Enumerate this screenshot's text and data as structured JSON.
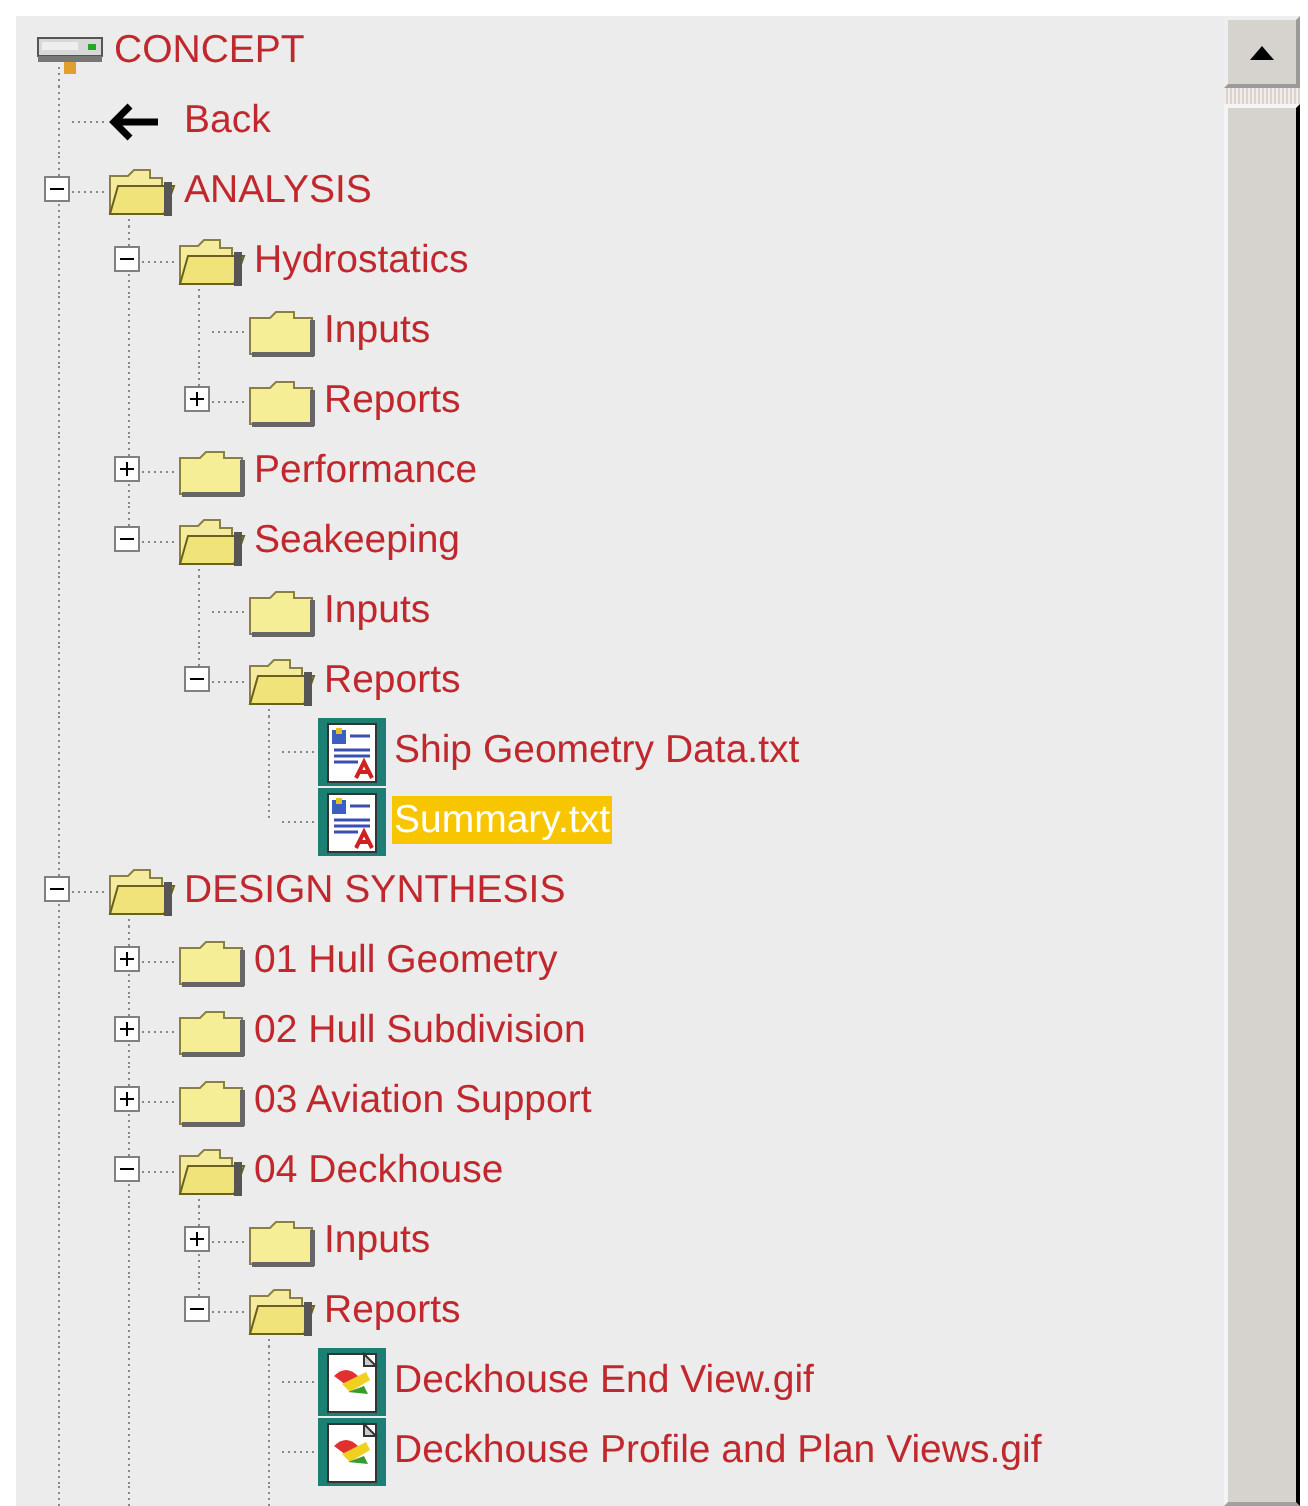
{
  "tree": [
    {
      "label": "CONCEPT",
      "kind": "root",
      "selected": false,
      "children": [
        {
          "label": "Back",
          "kind": "back",
          "selected": false
        },
        {
          "label": "ANALYSIS",
          "kind": "folder",
          "selected": false,
          "expanded": true,
          "children": [
            {
              "label": "Hydrostatics",
              "kind": "folder",
              "selected": false,
              "expanded": true,
              "children": [
                {
                  "label": "Inputs",
                  "kind": "folder",
                  "selected": false
                },
                {
                  "label": "Reports",
                  "kind": "folder",
                  "selected": false,
                  "expanded": false
                }
              ]
            },
            {
              "label": "Performance",
              "kind": "folder",
              "selected": false,
              "expanded": false
            },
            {
              "label": "Seakeeping",
              "kind": "folder",
              "selected": false,
              "expanded": true,
              "children": [
                {
                  "label": "Inputs",
                  "kind": "folder",
                  "selected": false
                },
                {
                  "label": "Reports",
                  "kind": "folder",
                  "selected": false,
                  "expanded": true,
                  "children": [
                    {
                      "label": "Ship Geometry Data.txt",
                      "kind": "text_file",
                      "selected": false
                    },
                    {
                      "label": "Summary.txt",
                      "kind": "text_file",
                      "selected": true
                    }
                  ]
                }
              ]
            }
          ]
        },
        {
          "label": "DESIGN SYNTHESIS",
          "kind": "folder",
          "selected": false,
          "expanded": true,
          "children": [
            {
              "label": "01 Hull Geometry",
              "kind": "folder",
              "selected": false,
              "expanded": false
            },
            {
              "label": "02 Hull Subdivision",
              "kind": "folder",
              "selected": false,
              "expanded": false
            },
            {
              "label": "03 Aviation Support",
              "kind": "folder",
              "selected": false,
              "expanded": false
            },
            {
              "label": "04 Deckhouse",
              "kind": "folder",
              "selected": false,
              "expanded": true,
              "children": [
                {
                  "label": "Inputs",
                  "kind": "folder",
                  "selected": false,
                  "expanded": false
                },
                {
                  "label": "Reports",
                  "kind": "folder",
                  "selected": false,
                  "expanded": true,
                  "children": [
                    {
                      "label": "Deckhouse End View.gif",
                      "kind": "image_file",
                      "selected": false
                    },
                    {
                      "label": "Deckhouse Profile and Plan Views.gif",
                      "kind": "image_file",
                      "selected": false
                    }
                  ]
                }
              ]
            }
          ]
        }
      ]
    }
  ]
}
